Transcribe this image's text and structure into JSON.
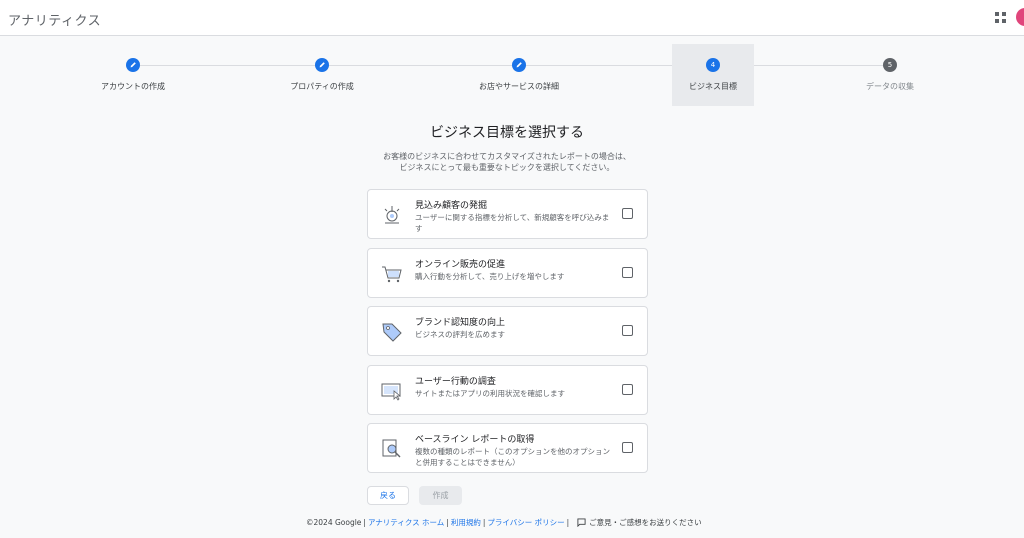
{
  "app": {
    "title": "アナリティクス"
  },
  "stepper": {
    "steps": [
      {
        "label": "アカウントの作成",
        "state": "done"
      },
      {
        "label": "プロパティの作成",
        "state": "done"
      },
      {
        "label": "お店やサービスの詳細",
        "state": "done"
      },
      {
        "label": "ビジネス目標",
        "state": "active",
        "number": "4"
      },
      {
        "label": "データの収集",
        "state": "upcoming",
        "number": "5"
      }
    ]
  },
  "main": {
    "heading": "ビジネス目標を選択する",
    "description_line1": "お客様のビジネスに合わせてカスタマイズされたレポートの場合は、",
    "description_line2": "ビジネスにとって最も重要なトピックを選択してください。",
    "options": [
      {
        "title": "見込み顧客の発掘",
        "subtitle": "ユーザーに関する指標を分析して、新規顧客を呼び込みます",
        "icon": "leads-icon",
        "checked": false
      },
      {
        "title": "オンライン販売の促進",
        "subtitle": "購入行動を分析して、売り上げを増やします",
        "icon": "cart-icon",
        "checked": false
      },
      {
        "title": "ブランド認知度の向上",
        "subtitle": "ビジネスの評判を広めます",
        "icon": "tag-icon",
        "checked": false
      },
      {
        "title": "ユーザー行動の調査",
        "subtitle": "サイトまたはアプリの利用状況を確認します",
        "icon": "screen-cursor-icon",
        "checked": false
      },
      {
        "title": "ベースライン レポートの取得",
        "subtitle": "複数の種類のレポート（このオプションを他のオプションと併用することはできません）",
        "icon": "report-search-icon",
        "checked": false
      }
    ],
    "back_label": "戻る",
    "create_label": "作成"
  },
  "footer": {
    "copyright": "©2024 Google",
    "home_link": "アナリティクス ホーム",
    "terms_link": "利用規約",
    "privacy_link": "プライバシー ポリシー",
    "feedback": "ご意見・ご感想をお送りください"
  },
  "colors": {
    "accent": "#1a73e8",
    "avatar": "#e0457b"
  }
}
